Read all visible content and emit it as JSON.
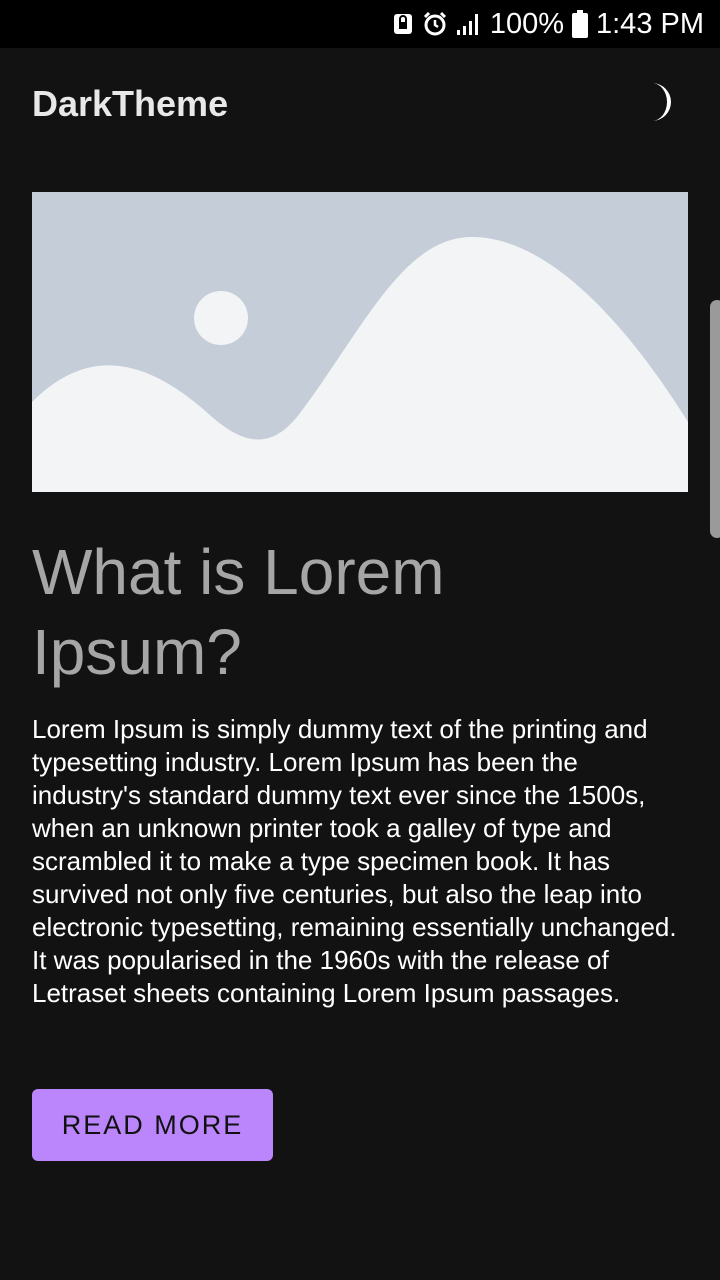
{
  "status_bar": {
    "battery_percent": "100%",
    "time": "1:43 PM",
    "icons": [
      "lock-status-icon",
      "alarm-icon",
      "signal-icon",
      "battery-icon"
    ]
  },
  "app_bar": {
    "title": "DarkTheme",
    "theme_toggle_icon": "moon-icon"
  },
  "hero": {
    "image_icon": "image-placeholder-icon",
    "colors": {
      "background": "#c5ced8",
      "shapes": "#f2f4f6"
    }
  },
  "article": {
    "headline": "What is Lorem Ipsum?",
    "body": "Lorem Ipsum is simply dummy text of the printing and typesetting industry. Lorem Ipsum has been the industry's standard dummy text ever since the 1500s, when an unknown printer took a galley of type and scrambled it to make a type specimen book. It has survived not only five centuries, but also the leap into electronic typesetting, remaining essentially unchanged. It was popularised in the 1960s with the release of Letraset sheets containing Lorem Ipsum passages.",
    "button_label": "READ MORE"
  },
  "colors": {
    "background": "#121212",
    "accent": "#bb86fc",
    "headline": "#a6a6a6",
    "body_text": "#ffffff"
  }
}
